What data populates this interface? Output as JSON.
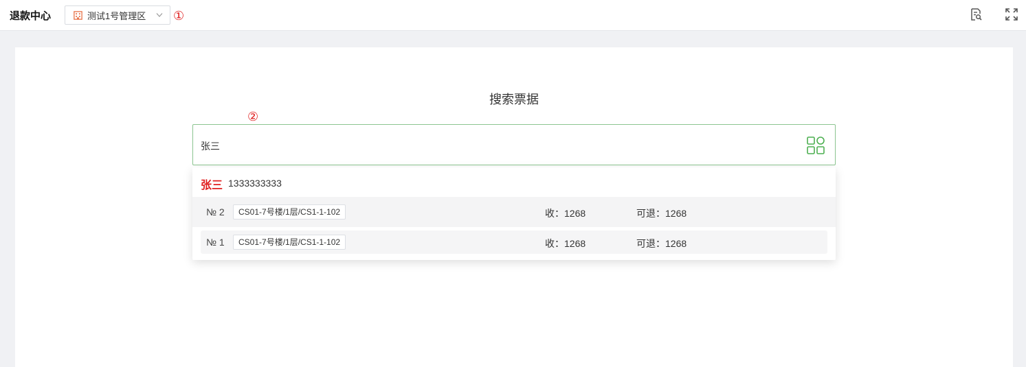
{
  "header": {
    "title": "退款中心",
    "zone_select": {
      "value": "测试1号管理区",
      "icon": "building-icon"
    },
    "marker": "①",
    "tools": [
      {
        "icon": "search-document-icon"
      },
      {
        "icon": "fullscreen-icon"
      }
    ]
  },
  "main": {
    "search_title": "搜索票据",
    "marker": "②",
    "search": {
      "value": "张三",
      "icon": "apps-grid-icon"
    },
    "dropdown": {
      "person": {
        "name": "张三",
        "phone": "1333333333"
      },
      "tickets": [
        {
          "no": "№ 2",
          "location": "CS01-7号楼/1层/CS1-1-102",
          "received": "收：1268",
          "refundable": "可退：1268"
        },
        {
          "no": "№ 1",
          "location": "CS01-7号楼/1层/CS1-1-102",
          "received": "收：1268",
          "refundable": "可退：1268"
        }
      ]
    }
  },
  "colors": {
    "accent_green": "#4caf50",
    "marker_red": "#e02020",
    "icon_orange": "#e8734a"
  }
}
